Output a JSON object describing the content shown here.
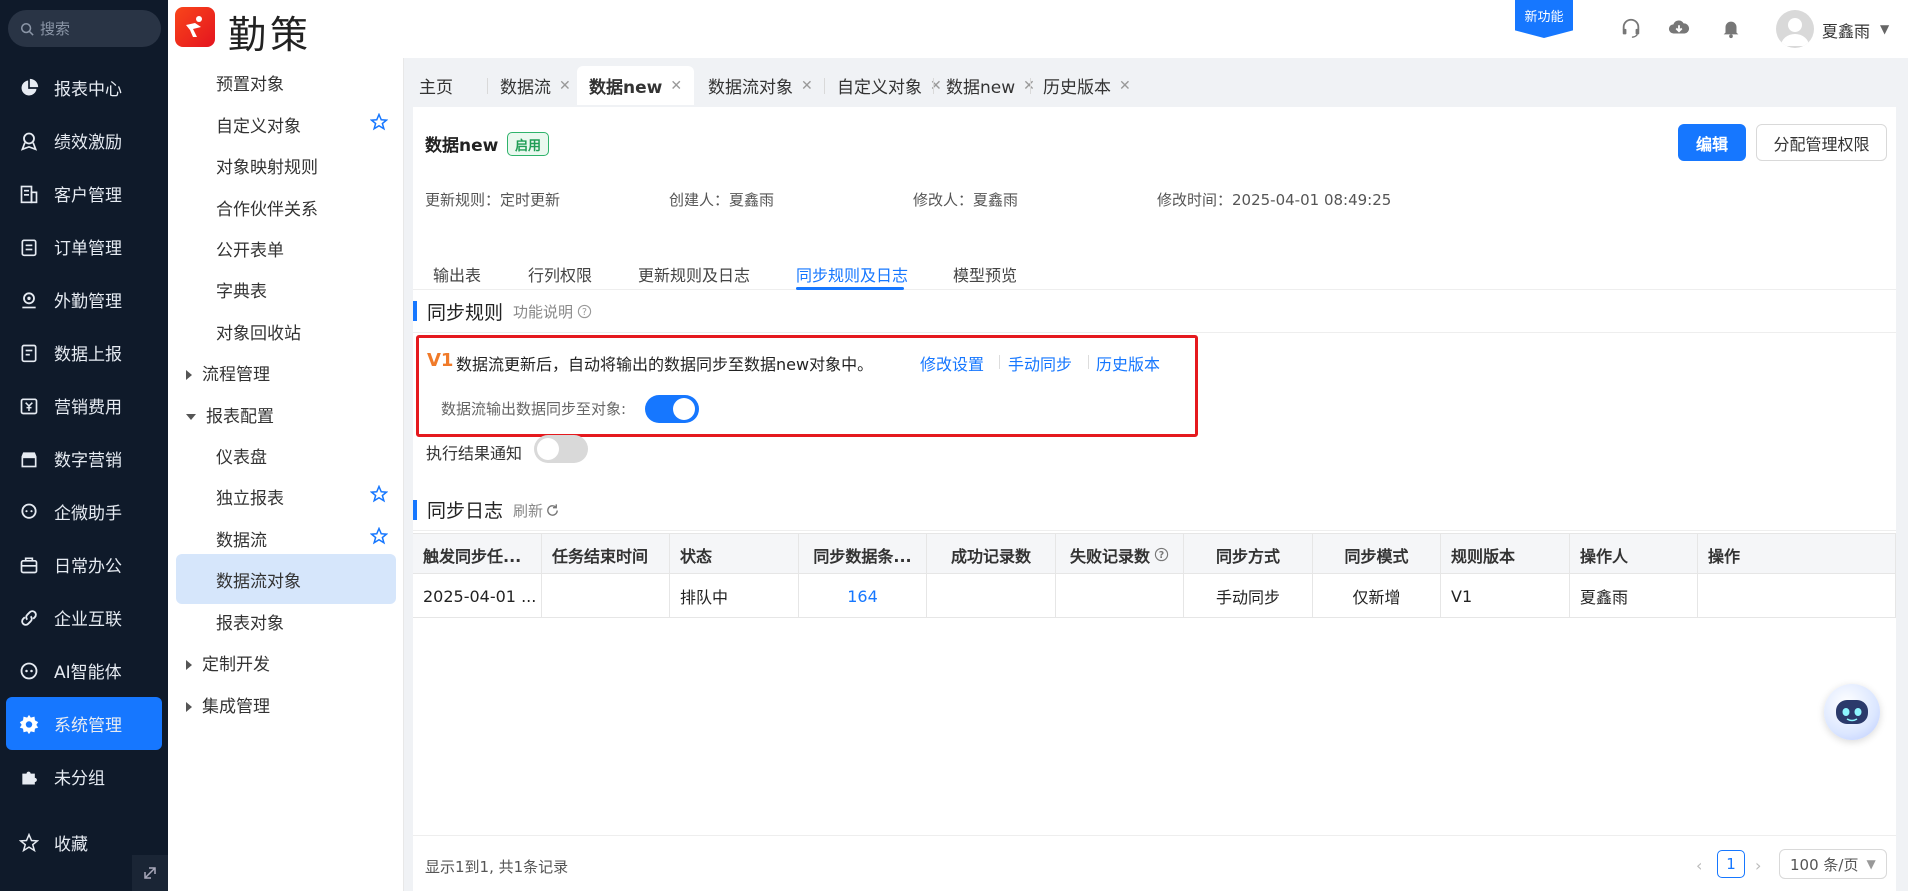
{
  "search": {
    "placeholder": "搜索"
  },
  "leftnav": {
    "items": [
      {
        "label": "报表中心",
        "icon": "pie-chart-icon"
      },
      {
        "label": "绩效激励",
        "icon": "award-icon"
      },
      {
        "label": "客户管理",
        "icon": "building-icon"
      },
      {
        "label": "订单管理",
        "icon": "clipboard-icon"
      },
      {
        "label": "外勤管理",
        "icon": "location-icon"
      },
      {
        "label": "数据上报",
        "icon": "report-icon"
      },
      {
        "label": "营销费用",
        "icon": "expense-icon"
      },
      {
        "label": "数字营销",
        "icon": "store-icon"
      },
      {
        "label": "企微助手",
        "icon": "chat-icon"
      },
      {
        "label": "日常办公",
        "icon": "briefcase-icon"
      },
      {
        "label": "企业互联",
        "icon": "link-icon"
      },
      {
        "label": "AI智能体",
        "icon": "robot-icon"
      },
      {
        "label": "系统管理",
        "icon": "gear-icon"
      },
      {
        "label": "未分组",
        "icon": "puzzle-icon"
      }
    ],
    "favorite": "收藏"
  },
  "header": {
    "brand": "勤策",
    "new_feature": "新功能",
    "username": "夏鑫雨"
  },
  "subnav": {
    "items": [
      {
        "label": "预置对象",
        "type": "item"
      },
      {
        "label": "自定义对象",
        "type": "item",
        "star": true
      },
      {
        "label": "对象映射规则",
        "type": "item"
      },
      {
        "label": "合作伙伴关系",
        "type": "item"
      },
      {
        "label": "公开表单",
        "type": "item"
      },
      {
        "label": "字典表",
        "type": "item"
      },
      {
        "label": "对象回收站",
        "type": "item"
      },
      {
        "label": "流程管理",
        "type": "group-collapsed"
      },
      {
        "label": "报表配置",
        "type": "group-expanded"
      },
      {
        "label": "仪表盘",
        "type": "item"
      },
      {
        "label": "独立报表",
        "type": "item",
        "star": true
      },
      {
        "label": "数据流",
        "type": "item",
        "star": true
      },
      {
        "label": "数据流对象",
        "type": "item",
        "active": true
      },
      {
        "label": "报表对象",
        "type": "item"
      },
      {
        "label": "定制开发",
        "type": "group-collapsed"
      },
      {
        "label": "集成管理",
        "type": "group-collapsed"
      }
    ]
  },
  "tabs": [
    {
      "label": "主页",
      "closable": false
    },
    {
      "label": "数据流",
      "closable": true
    },
    {
      "label": "数据new",
      "closable": true,
      "active": true
    },
    {
      "label": "数据流对象",
      "closable": true
    },
    {
      "label": "自定义对象",
      "closable": true
    },
    {
      "label": "数据new",
      "closable": true
    },
    {
      "label": "历史版本",
      "closable": true
    }
  ],
  "detail": {
    "title": "数据new",
    "status": "启用",
    "edit_button": "编辑",
    "assign_button": "分配管理权限",
    "meta": {
      "update_rule": "更新规则：定时更新",
      "creator": "创建人：夏鑫雨",
      "modifier": "修改人：夏鑫雨",
      "modified_time": "修改时间：2025-04-01 08:49:25"
    },
    "subtabs": [
      "输出表",
      "行列权限",
      "更新规则及日志",
      "同步规则及日志",
      "模型预览"
    ],
    "active_subtab": 3
  },
  "sync_rule": {
    "title": "同步规则",
    "help": "功能说明",
    "version": "V1",
    "description": "数据流更新后，自动将输出的数据同步至数据new对象中。",
    "links": [
      "修改设置",
      "手动同步",
      "历史版本"
    ],
    "toggle_label": "数据流输出数据同步至对象:",
    "toggle_on": true,
    "notify_label": "执行结果通知",
    "notify_on": false
  },
  "sync_log": {
    "title": "同步日志",
    "refresh": "刷新",
    "columns": [
      "触发同步任...",
      "任务结束时间",
      "状态",
      "同步数据条...",
      "成功记录数",
      "失败记录数",
      "同步方式",
      "同步模式",
      "规则版本",
      "操作人",
      "操作"
    ],
    "rows": [
      [
        "2025-04-01 ...",
        "",
        "排队中",
        "164",
        "",
        "",
        "手动同步",
        "仅新增",
        "V1",
        "夏鑫雨",
        ""
      ]
    ]
  },
  "footer": {
    "info": "显示1到1, 共1条记录",
    "current_page": "1",
    "page_size": "100 条/页"
  }
}
